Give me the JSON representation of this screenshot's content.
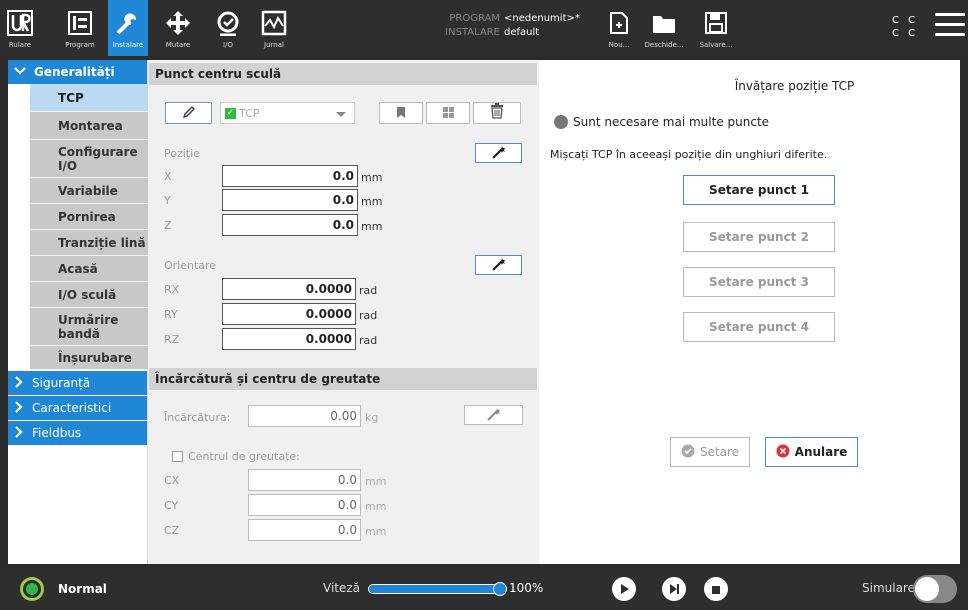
{
  "header": {
    "nav": [
      {
        "label": "Rulare",
        "icon": "ur-logo-icon"
      },
      {
        "label": "Program",
        "icon": "program-icon"
      },
      {
        "label": "Instalare",
        "icon": "install-icon",
        "active": true
      },
      {
        "label": "Mutare",
        "icon": "move-icon"
      },
      {
        "label": "I/O",
        "icon": "io-icon"
      },
      {
        "label": "Jurnal",
        "icon": "log-icon"
      }
    ],
    "program_key": "PROGRAM",
    "program_value": "<nedenumit>*",
    "install_key": "INSTALARE",
    "install_value": "default",
    "file_buttons": [
      {
        "label": "Nou...",
        "icon": "new-file-icon"
      },
      {
        "label": "Deschide...",
        "icon": "open-folder-icon"
      },
      {
        "label": "Salvare...",
        "icon": "save-icon"
      }
    ],
    "cc_top": "C C",
    "cc_bottom": "C C"
  },
  "sidebar": {
    "section_general": "Generalități",
    "items": [
      "TCP",
      "Montarea",
      "Configurare I/O",
      "Variabile",
      "Pornirea",
      "Tranziție lină",
      "Acasă",
      "I/O sculă",
      "Urmărire bandă",
      "Înșurubare"
    ],
    "collapsed_sections": [
      "Siguranță",
      "Caracteristici",
      "Fieldbus"
    ]
  },
  "tcp_panel": {
    "title": "Punct centru sculă",
    "tcp_name": "TCP",
    "position_label": "Poziție",
    "position": [
      {
        "axis": "X",
        "value": "0.0",
        "unit": "mm"
      },
      {
        "axis": "Y",
        "value": "0.0",
        "unit": "mm"
      },
      {
        "axis": "Z",
        "value": "0.0",
        "unit": "mm"
      }
    ],
    "orientation_label": "Orientare",
    "orientation": [
      {
        "axis": "RX",
        "value": "0.0000",
        "unit": "rad"
      },
      {
        "axis": "RY",
        "value": "0.0000",
        "unit": "rad"
      },
      {
        "axis": "RZ",
        "value": "0.0000",
        "unit": "rad"
      }
    ]
  },
  "payload_panel": {
    "title": "Încărcătură și centru de greutate",
    "payload_label": "Încărcătura:",
    "payload_value": "0.00",
    "payload_unit": "kg",
    "cog_label": "Centrul de greutate:",
    "cog": [
      {
        "axis": "CX",
        "value": "0.0",
        "unit": "mm"
      },
      {
        "axis": "CY",
        "value": "0.0",
        "unit": "mm"
      },
      {
        "axis": "CZ",
        "value": "0.0",
        "unit": "mm"
      }
    ]
  },
  "teach_panel": {
    "title": "Învățare poziție TCP",
    "status": "Sunt necesare mai multe puncte",
    "instruction": "Mișcați TCP în aceeași poziție din unghiuri diferite.",
    "set_points": [
      "Setare punct 1",
      "Setare punct 2",
      "Setare punct 3",
      "Setare punct 4"
    ],
    "set_button": "Setare",
    "cancel_button": "Anulare"
  },
  "footer": {
    "status": "Normal",
    "speed_label": "Viteză",
    "speed_value": "100%",
    "speed_fraction": 1.0,
    "simulation_label": "Simulare"
  },
  "colors": {
    "accent": "#1f87d6",
    "header_bg": "#2e2e2e",
    "status_ok": "#35b24a",
    "cancel_red": "#e03030"
  }
}
